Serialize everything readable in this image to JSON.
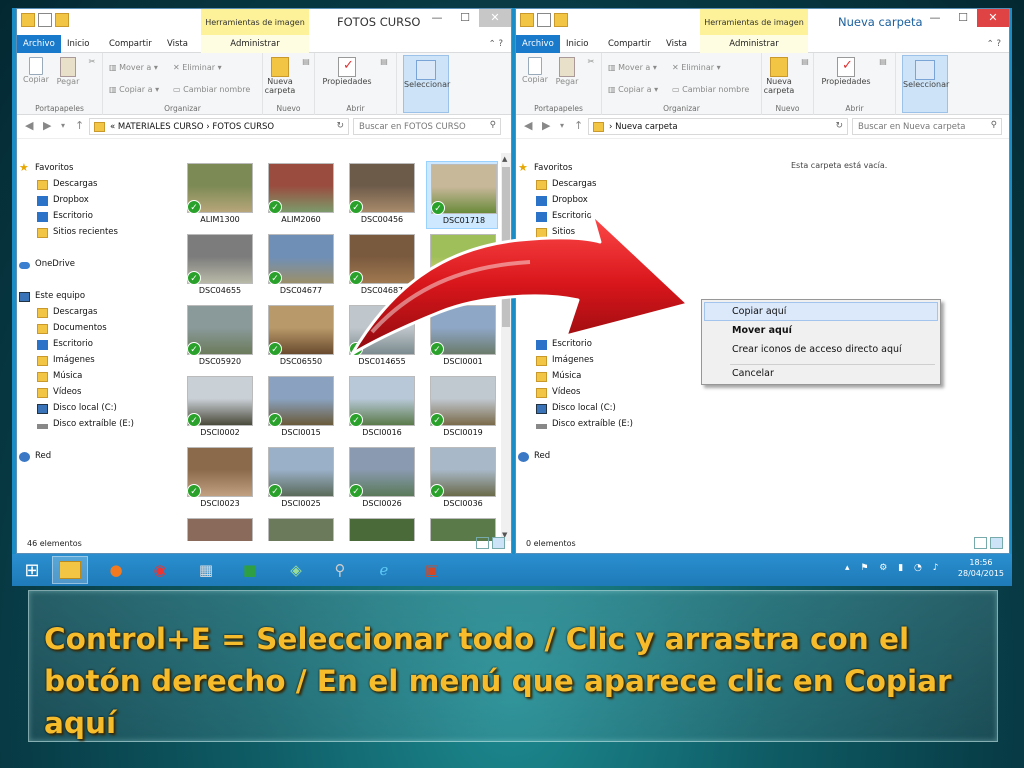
{
  "left_window": {
    "title": "FOTOS CURSO",
    "contextual_tab": "Herramientas de imagen",
    "tabs": [
      "Archivo",
      "Inicio",
      "Compartir",
      "Vista",
      "Administrar"
    ],
    "ribbon": {
      "copy": "Copiar",
      "paste": "Pegar",
      "move_to": "Mover a",
      "copy_to": "Copiar a",
      "delete": "Eliminar",
      "rename": "Cambiar nombre",
      "new_folder": "Nueva carpeta",
      "properties": "Propiedades",
      "select": "Seleccionar",
      "groups": [
        "Portapapeles",
        "Organizar",
        "Nuevo",
        "Abrir"
      ]
    },
    "address": [
      "MATERIALES CURSO",
      "FOTOS CURSO"
    ],
    "search_placeholder": "Buscar en FOTOS CURSO",
    "nav": {
      "favorites": "Favoritos",
      "favorite_items": [
        "Descargas",
        "Dropbox",
        "Escritorio",
        "Sitios recientes"
      ],
      "onedrive": "OneDrive",
      "this_pc": "Este equipo",
      "pc_items": [
        "Descargas",
        "Documentos",
        "Escritorio",
        "Imágenes",
        "Música",
        "Vídeos",
        "Disco local (C:)",
        "Disco extraíble (E:)"
      ],
      "network": "Red"
    },
    "files": [
      "ALIM1300",
      "ALIM2060",
      "DSC00456",
      "DSC01718",
      "DSC04655",
      "DSC04677",
      "DSC04687",
      "",
      "DSC05920",
      "DSC06550",
      "DSC014655",
      "DSCI0001",
      "DSCI0002",
      "DSCI0015",
      "DSCI0016",
      "DSCI0019",
      "DSCI0023",
      "DSCI0025",
      "DSCI0026",
      "DSCI0036",
      "",
      "",
      "",
      ""
    ],
    "status": "46 elementos"
  },
  "right_window": {
    "title": "Nueva carpeta",
    "contextual_tab": "Herramientas de imagen",
    "tabs": [
      "Archivo",
      "Inicio",
      "Compartir",
      "Vista",
      "Administrar"
    ],
    "ribbon": {
      "copy": "Copiar",
      "paste": "Pegar",
      "move_to": "Mover a",
      "copy_to": "Copiar a",
      "delete": "Eliminar",
      "rename": "Cambiar nombre",
      "new_folder": "Nueva carpeta",
      "properties": "Propiedades",
      "select": "Seleccionar",
      "groups": [
        "Portapapeles",
        "Organizar",
        "Nuevo",
        "Abrir"
      ]
    },
    "address": [
      "Nueva carpeta"
    ],
    "search_placeholder": "Buscar en Nueva carpeta",
    "nav": {
      "favorites": "Favoritos",
      "favorite_items": [
        "Descargas",
        "Dropbox",
        "Escritorio",
        "Sitios"
      ],
      "pc_items": [
        "Escritorio",
        "Imágenes",
        "Música",
        "Vídeos",
        "Disco local (C:)",
        "Disco extraíble (E:)"
      ],
      "network": "Red"
    },
    "empty_message": "Esta carpeta está vacía.",
    "status": "0 elementos"
  },
  "context_menu": {
    "items": [
      "Copiar aquí",
      "Mover aquí",
      "Crear iconos de acceso directo aquí",
      "Cancelar"
    ]
  },
  "taskbar": {
    "time": "18:56",
    "date": "28/04/2015"
  },
  "caption": "Control+E = Seleccionar todo / Clic y arrastra con el botón derecho / En el menú que aparece clic en Copiar aquí",
  "colors": {
    "accent": "#1979ca",
    "contextual_tab": "#fdf29a",
    "caption_text": "#f6bc2c",
    "arrow": "#d8161b",
    "checkmark": "#2aa12a"
  }
}
